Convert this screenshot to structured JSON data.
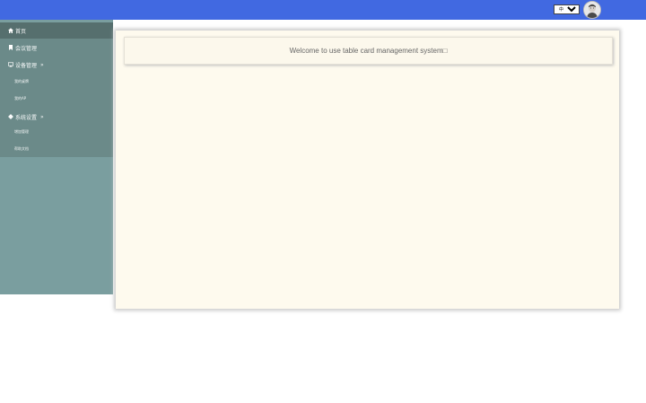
{
  "header": {
    "language": {
      "selected": "中文简体"
    },
    "colors": {
      "topbar": "#4169e1"
    }
  },
  "sidebar": {
    "items": [
      {
        "label": "首页",
        "icon": "home-icon",
        "active": true
      },
      {
        "label": "会议管理",
        "icon": "bookmark-icon"
      },
      {
        "label": "设备管理",
        "icon": "monitor-icon",
        "arrow": "»",
        "children": [
          {
            "label": "我的桌牌"
          },
          {
            "label": "我的AP"
          }
        ]
      },
      {
        "label": "系统设置",
        "icon": "gear-icon",
        "arrow": "»",
        "children": [
          {
            "label": "增加管理"
          },
          {
            "label": "帮助文档"
          }
        ]
      }
    ]
  },
  "main": {
    "welcome_text": "Welcome to use table card management system□"
  }
}
